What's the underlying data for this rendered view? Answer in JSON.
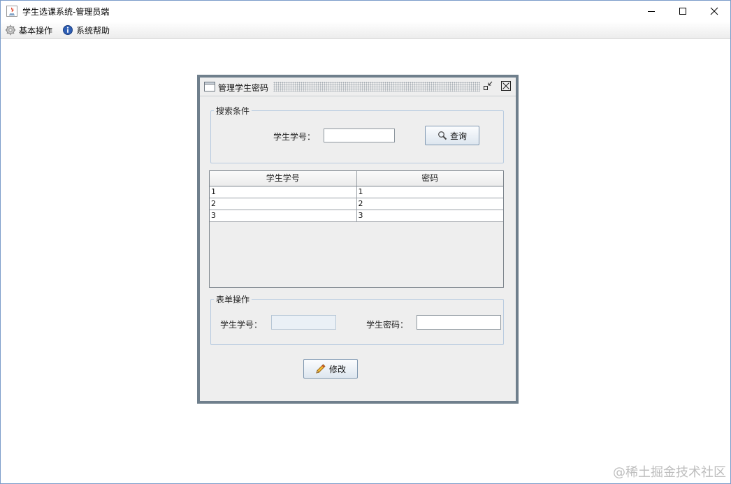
{
  "window": {
    "title": "学生选课系统-管理员端",
    "minimize_icon": "minimize-icon",
    "maximize_icon": "maximize-icon",
    "close_icon": "close-icon"
  },
  "menubar": {
    "items": [
      {
        "label": "基本操作",
        "icon": "gear-icon"
      },
      {
        "label": "系统帮助",
        "icon": "info-icon"
      }
    ]
  },
  "dialog": {
    "title": "管理学生密码",
    "search": {
      "legend": "搜索条件",
      "student_id_label": "学生学号：",
      "student_id_value": "",
      "query_button": "查询"
    },
    "table": {
      "columns": [
        "学生学号",
        "密码"
      ],
      "rows": [
        [
          "1",
          "1"
        ],
        [
          "2",
          "2"
        ],
        [
          "3",
          "3"
        ]
      ]
    },
    "form": {
      "legend": "表单操作",
      "student_id_label": "学生学号：",
      "student_id_value": "",
      "password_label": "学生密码：",
      "password_value": ""
    },
    "modify_button": "修改"
  },
  "watermark": "@稀土掘金技术社区",
  "colors": {
    "frame_border": "#6f7f8c",
    "panel_bg": "#eeeeee",
    "fieldset_border": "#b8cbe0",
    "button_border": "#7f97b0"
  }
}
